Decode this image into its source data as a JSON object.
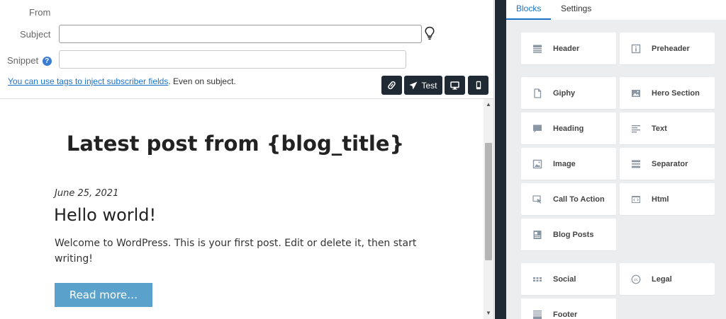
{
  "form": {
    "from_label": "From",
    "subject_label": "Subject",
    "subject_value": "",
    "snippet_label": "Snippet",
    "snippet_help": "?",
    "snippet_value": "",
    "tags_link": "You can use tags to inject subscriber fields",
    "tags_suffix": ". Even on subject."
  },
  "toolbar": {
    "test_label": "Test"
  },
  "preview": {
    "heading": "Latest post from {blog_title}",
    "post_date": "June 25, 2021",
    "post_title": "Hello world!",
    "post_excerpt": "Welcome to WordPress. This is your first post. Edit or delete it, then start writing!",
    "read_more": "Read more…"
  },
  "sidebar": {
    "tabs": [
      {
        "label": "Blocks",
        "active": true
      },
      {
        "label": "Settings",
        "active": false
      }
    ],
    "blocks": [
      {
        "label": "Header",
        "icon": "header-icon"
      },
      {
        "label": "Preheader",
        "icon": "preheader-icon"
      },
      {
        "label": "Giphy",
        "icon": "giphy-icon"
      },
      {
        "label": "Hero Section",
        "icon": "hero-section-icon"
      },
      {
        "label": "Heading",
        "icon": "heading-icon"
      },
      {
        "label": "Text",
        "icon": "text-icon"
      },
      {
        "label": "Image",
        "icon": "image-icon"
      },
      {
        "label": "Separator",
        "icon": "separator-icon"
      },
      {
        "label": "Call To Action",
        "icon": "call-to-action-icon"
      },
      {
        "label": "Html",
        "icon": "html-icon"
      },
      {
        "label": "Blog Posts",
        "icon": "blog-posts-icon"
      },
      {
        "label": "Social",
        "icon": "social-icon"
      },
      {
        "label": "Legal",
        "icon": "legal-icon"
      },
      {
        "label": "Footer",
        "icon": "footer-icon"
      }
    ]
  },
  "colors": {
    "accent": "#1a73c8",
    "toolbar_button": "#1f2a35",
    "read_more": "#5aa2cc",
    "sidebar_bg": "#ebedef"
  }
}
